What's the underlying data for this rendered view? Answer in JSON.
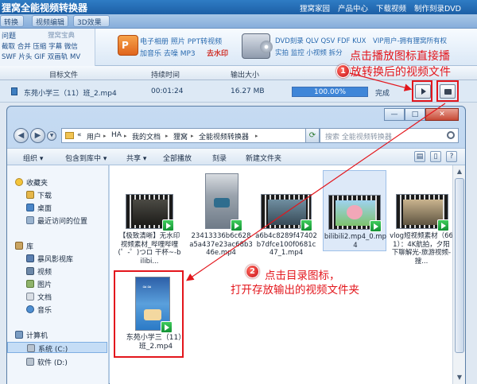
{
  "app": {
    "title": "狸窝全能视频转换器",
    "top_links": [
      "狸窝家园",
      "产品中心",
      "下载视频",
      "制作刻录DVD"
    ],
    "tabs": [
      "转换",
      "视频编辑",
      "3D效果"
    ]
  },
  "banner": {
    "left_title": "问题",
    "left_brand": "狸窝宝典",
    "left_line1": "截取 合并 压缩 字幕 微信",
    "left_line2": "SWF 片头 GIF 双画轨 MV",
    "promo1_line1": "电子相册  照片  PPT转视频",
    "promo1_line2": "加音乐  去噪  MP3",
    "promo1_red": "去水印",
    "promo2_line1": "DVD刻录  QLV  QSV  FDF  KUX",
    "promo2_line2": "实拍  监控  小视频  拆分",
    "vip": "VIP用户-拥有狸窝所有权"
  },
  "file_list": {
    "col_target": "目标文件",
    "col_duration": "持续时间",
    "col_size": "输出大小",
    "row_name": "东苑小学三（11）班_2.mp4",
    "row_duration": "00:01:24",
    "row_size": "16.27 MB",
    "row_progress_label": "100.00%",
    "row_progress": 1.0,
    "row_status": "完成"
  },
  "annotations": {
    "step1_badge": "1",
    "step1_line1": "点击播放图标直接播",
    "step1_line2": "放转换后的视频文件",
    "step2_badge": "2",
    "step2_line1": "点击目录图标，",
    "step2_line2": "打开存放输出的视频文件夹",
    "color": "#e3161c"
  },
  "explorer": {
    "back_icon": "back-arrow-icon",
    "path": [
      "用户",
      "HA",
      "我的文档",
      "狸窝",
      "全能视频转换器"
    ],
    "path_prefix": "«",
    "search_placeholder": "搜索 全能视频转换器",
    "toolbar": [
      "组织 ▾",
      "包含到库中 ▾",
      "共享 ▾",
      "全部播放",
      "刻录",
      "新建文件夹"
    ],
    "nav": [
      {
        "label": "收藏夹",
        "icon": "star-icon"
      },
      {
        "label": "下载",
        "icon": "download-folder-icon"
      },
      {
        "label": "桌面",
        "icon": "desktop-icon"
      },
      {
        "label": "最近访问的位置",
        "icon": "recent-icon"
      },
      {
        "label": "库",
        "icon": "library-icon"
      },
      {
        "label": "暴风影视库",
        "icon": "video-library-icon"
      },
      {
        "label": "视频",
        "icon": "video-folder-icon"
      },
      {
        "label": "图片",
        "icon": "picture-folder-icon"
      },
      {
        "label": "文档",
        "icon": "document-folder-icon"
      },
      {
        "label": "音乐",
        "icon": "music-folder-icon"
      },
      {
        "label": "计算机",
        "icon": "computer-icon"
      },
      {
        "label": "系统 (C:)",
        "icon": "drive-icon"
      },
      {
        "label": "软件 (D:)",
        "icon": "drive-icon"
      }
    ],
    "files": [
      {
        "name": "【极致清晰】无水印视频素材_哔哩哔哩 (゜-゜)つロ 干杯~-bilibi..."
      },
      {
        "name": "23413336b6c628a5a437e23ac68b346e.mp4"
      },
      {
        "name": "a6b4c8289f47402b7dfce100f0681c47_1.mp4"
      },
      {
        "name": "bilibili2.mp4_0.mp4"
      },
      {
        "name": "vlog短视频素材（661）：4K航拍，夕阳下聊解光-旅游视频-搜..."
      },
      {
        "name": "东苑小学三（11）班_2.mp4"
      }
    ]
  }
}
